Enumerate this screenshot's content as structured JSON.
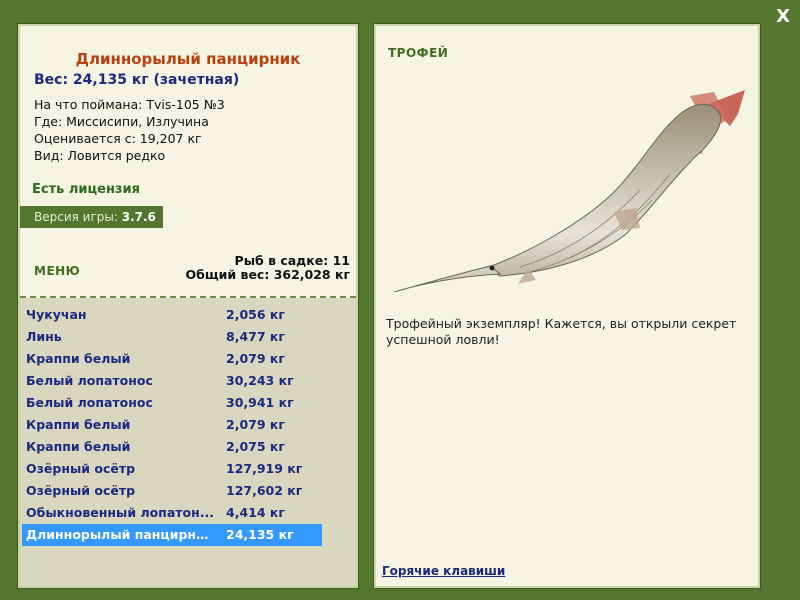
{
  "close_label": "X",
  "left": {
    "title": "Длиннорылый панцирник",
    "weight": "Вес: 24,135 кг (зачетная)",
    "info": [
      "На что поймана: Tvis-105 №3",
      "Где: Миссисипи, Излучина",
      "Оценивается с: 19,207 кг",
      "Вид: Ловится редко"
    ],
    "license": "Есть лицензия",
    "version_label": "Версия игры:",
    "version_value": "3.7.6",
    "menu_label": "МЕНЮ",
    "keepnet_count": "Рыб в садке: 11",
    "keepnet_total": "Общий вес: 362,028 кг",
    "fish_list": [
      {
        "name": "Чукучан",
        "weight": "2,056 кг"
      },
      {
        "name": "Линь",
        "weight": "8,477 кг"
      },
      {
        "name": "Краппи белый",
        "weight": "2,079 кг"
      },
      {
        "name": "Белый лопатонос",
        "weight": "30,243 кг"
      },
      {
        "name": "Белый лопатонос",
        "weight": "30,941 кг"
      },
      {
        "name": "Краппи белый",
        "weight": "2,079 кг"
      },
      {
        "name": "Краппи белый",
        "weight": "2,075 кг"
      },
      {
        "name": "Озёрный осётр",
        "weight": "127,919 кг"
      },
      {
        "name": "Озёрный осётр",
        "weight": "127,602 кг"
      },
      {
        "name": "Обыкновенный лопатон...",
        "weight": "4,414 кг"
      },
      {
        "name": "Длиннорылый панцирни...",
        "weight": "24,135 кг"
      }
    ],
    "selected_index": 10
  },
  "right": {
    "trophy_label": "ТРОФЕЙ",
    "trophy_text": "Трофейный экземпляр! Кажется, вы открыли секрет успешной ловли!",
    "hotkeys_label": "Горячие клавиши"
  },
  "colors": {
    "frame": "#55762f",
    "panel": "#f6f4e2",
    "title": "#b8400e",
    "selected": "#3399ff"
  }
}
